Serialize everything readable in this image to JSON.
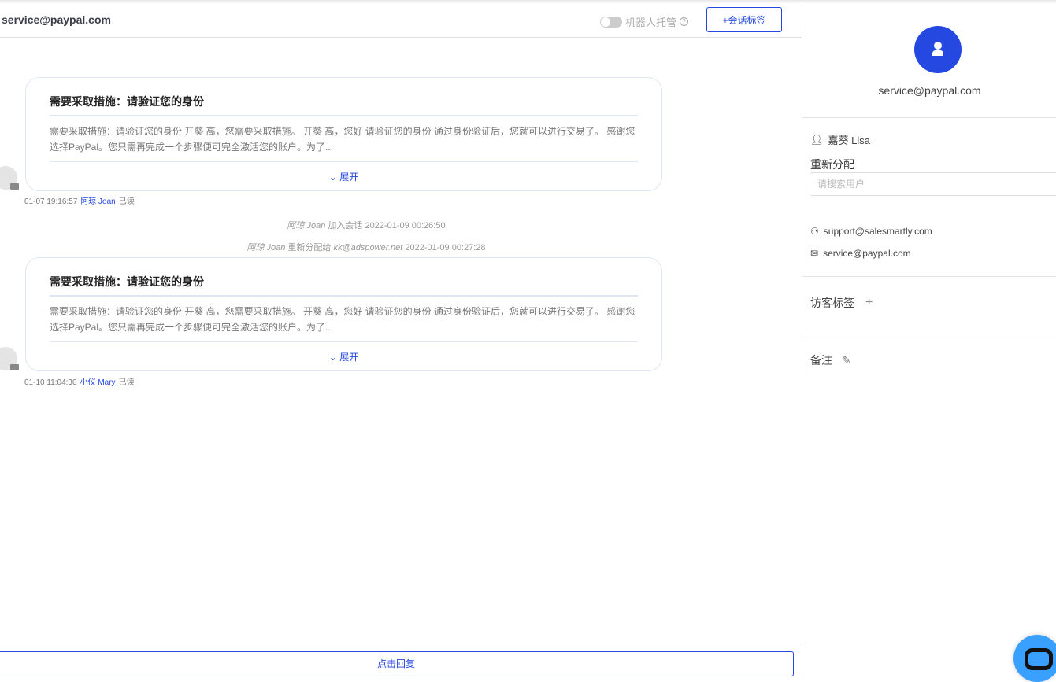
{
  "header": {
    "title": "service@paypal.com",
    "robot_label": "机器人托管",
    "help": "?",
    "tag_button": "+会话标签"
  },
  "messages": [
    {
      "subject": "需要采取措施：请验证您的身份",
      "body": "需要采取措施：请验证您的身份 开葵 高，您需要采取措施。 开葵 高，您好 请验证您的身份 通过身份验证后，您就可以进行交易了。 感谢您选择PayPal。您只需再完成一个步骤便可完全激活您的账户。为了...",
      "expand": "展开",
      "time": "01-07 19:16:57",
      "agent": "阿琼 Joan",
      "status": "已读"
    },
    {
      "subject": "需要采取措施：请验证您的身份",
      "body": "需要采取措施：请验证您的身份 开葵 高，您需要采取措施。 开葵 高，您好 请验证您的身份 通过身份验证后，您就可以进行交易了。 感谢您选择PayPal。您只需再完成一个步骤便可完全激活您的账户。为了...",
      "expand": "展开",
      "time": "01-10 11:04:30",
      "agent": "小仪 Mary",
      "status": "已读"
    }
  ],
  "system": [
    {
      "actor": "阿琼 Joan",
      "text": "加入会话 2022-01-09 00:26:50"
    },
    {
      "actor": "阿琼 Joan",
      "text": "重新分配给",
      "target": "kk@adspower.net",
      "time": "2022-01-09 00:27:28"
    }
  ],
  "footer": {
    "reply": "点击回复"
  },
  "sidebar": {
    "email": "service@paypal.com",
    "assignee": "嘉葵 Lisa",
    "reassign_label": "重新分配",
    "search_placeholder": "请搜索用户",
    "channel_email": "support@salesmartly.com",
    "contact_email": "service@paypal.com",
    "visitor_tags": "访客标签",
    "notes": "备注"
  },
  "colors": {
    "accent": "#2448e0",
    "chat_widget": "#3aa0ff"
  }
}
